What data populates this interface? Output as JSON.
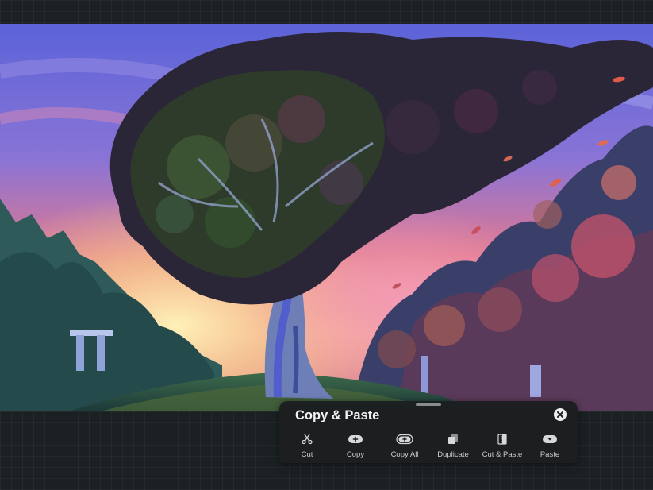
{
  "panel": {
    "title": "Copy & Paste",
    "actions": [
      {
        "label": "Cut",
        "icon": "scissors-icon"
      },
      {
        "label": "Copy",
        "icon": "plus-pill-icon"
      },
      {
        "label": "Copy All",
        "icon": "plus-pill-outline-icon"
      },
      {
        "label": "Duplicate",
        "icon": "duplicate-layers-icon"
      },
      {
        "label": "Cut & Paste",
        "icon": "split-layer-icon"
      },
      {
        "label": "Paste",
        "icon": "paste-chevron-icon"
      }
    ]
  },
  "colors": {
    "app_background": "#1b2123",
    "panel_background": "#1c1e20",
    "panel_text": "#f2f2f2",
    "action_label": "#c9cbcd"
  }
}
